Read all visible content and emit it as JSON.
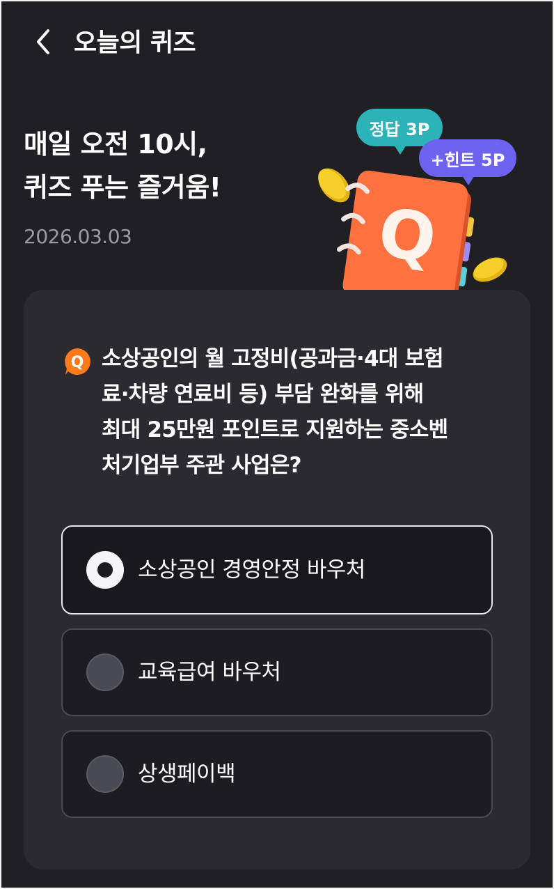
{
  "header": {
    "title": "오늘의 퀴즈"
  },
  "hero": {
    "title_line1": "매일 오전 10시,",
    "title_line2": "퀴즈 푸는 즐거움!",
    "date": "2026.03.03",
    "bubble_correct": "정답 3P",
    "bubble_hint": "+힌트 5P",
    "notebook_letter": "Q"
  },
  "quiz": {
    "badge": "Q",
    "question_lines": [
      "소상공인의 월 고정비(공과금·4대 보험",
      "료·차량 연료비 등) 부담 완화를 위해",
      "최대 25만원 포인트로 지원하는 중소벤",
      "처기업부 주관 사업은?"
    ],
    "options": [
      {
        "label": "소상공인 경영안정 바우처",
        "selected": true
      },
      {
        "label": "교육급여 바우처",
        "selected": false
      },
      {
        "label": "상생페이백",
        "selected": false
      }
    ]
  },
  "colors": {
    "background": "#1f1f24",
    "card": "#2a2a30",
    "accent_orange": "#ff7a1a",
    "bubble_teal": "#2bb3b8",
    "bubble_purple": "#6e63f0"
  }
}
